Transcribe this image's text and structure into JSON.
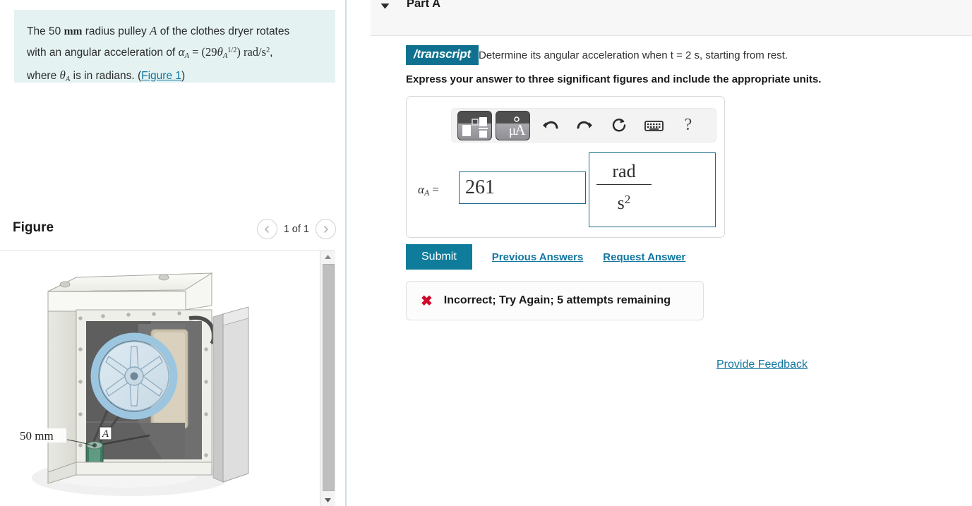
{
  "problem": {
    "text_plain": "The 50 mm radius pulley A of the clothes dryer rotates with an angular acceleration of α_A = (29θ_A^(1/2)) rad/s², where θ_A is in radians. (Figure 1)",
    "line1_pre": "The 50 ",
    "line1_unit": "mm",
    "line1_mid": " radius pulley ",
    "line1_var": "A",
    "line1_post": " of the clothes dryer rotates",
    "line2_pre": "with an angular acceleration of ",
    "line2_alpha": "α",
    "line2_alpha_sub": "A",
    "line2_eq": " = ",
    "line2_expr_open": "(29",
    "line2_theta": "θ",
    "line2_theta_sub": "A",
    "line2_theta_sup": "1/2",
    "line2_expr_close": ")",
    "line2_units": " rad/s",
    "line2_units_sup": "2",
    "line2_comma": ",",
    "line3_pre": "where ",
    "line3_theta": "θ",
    "line3_theta_sub": "A",
    "line3_mid": " is in radians. (",
    "line3_link": "Figure 1",
    "line3_post": ")"
  },
  "figure": {
    "title": "Figure",
    "pager_label": "1 of 1",
    "prev_icon": "chevron-left-icon",
    "next_icon": "chevron-right-icon",
    "dimension_label": "50 mm",
    "pulley_label": "A",
    "scroll_up_icon": "triangle-up-icon",
    "scroll_down_icon": "triangle-down-icon"
  },
  "part": {
    "title": "Part A",
    "caret_icon": "chevron-down-icon",
    "transcript_badge": "/transcript",
    "question": "Determine its angular acceleration when  t  = 2 s, starting from rest.",
    "instruction": "Express your answer to three significant figures and include the appropriate units."
  },
  "editor": {
    "toolbar": [
      {
        "name": "math-template-button",
        "icon": "formula-template-icon",
        "label": ""
      },
      {
        "name": "units-button",
        "icon": "micro-angstrom-icon",
        "label": "μÅ"
      },
      {
        "name": "undo-button",
        "icon": "undo-arrow-icon",
        "label": ""
      },
      {
        "name": "redo-button",
        "icon": "redo-arrow-icon",
        "label": ""
      },
      {
        "name": "reset-button",
        "icon": "refresh-circle-icon",
        "label": ""
      },
      {
        "name": "keyboard-button",
        "icon": "keyboard-icon",
        "label": ""
      },
      {
        "name": "help-button",
        "icon": "question-mark-icon",
        "label": "?"
      }
    ],
    "answer_symbol": "α",
    "answer_symbol_sub": "A",
    "answer_equals": "=",
    "answer_value": "261",
    "units_numerator": "rad",
    "units_denominator": "s",
    "units_denominator_exp": "2"
  },
  "actions": {
    "submit_label": "Submit",
    "previous_answers_label": "Previous Answers",
    "request_answer_label": "Request Answer",
    "provide_feedback_label": "Provide Feedback"
  },
  "feedback": {
    "icon": "x-mark-icon",
    "icon_glyph": "✖",
    "message": "Incorrect; Try Again; 5 attempts remaining"
  },
  "colors": {
    "teal_accent": "#0f7c9c",
    "link_blue": "#1276a0",
    "badge_teal": "#0f718f",
    "problem_panel_bg": "#e4f2f2",
    "error_red": "#cf0a2c",
    "field_border": "#1a6b8a"
  }
}
